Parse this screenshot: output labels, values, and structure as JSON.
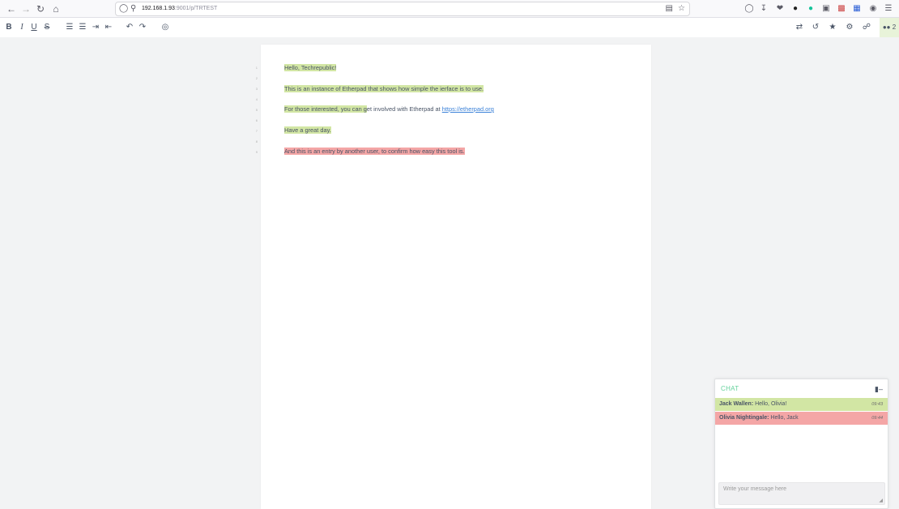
{
  "browser": {
    "url_host": "192.168.1.93",
    "url_rest": ":9001/p/TRTEST",
    "icons": [
      "back-icon",
      "forward-icon",
      "reload-icon",
      "home-icon"
    ],
    "extension_icons": [
      "pocket-icon",
      "download-icon",
      "extension-icon",
      "extension-icon-2",
      "grammarly-icon",
      "reader-icon",
      "extension-icon-3",
      "extension-icon-4",
      "extension-icon-5",
      "menu-icon"
    ]
  },
  "toolbar": {
    "left": [
      "bold-icon",
      "italic-icon",
      "underline-icon",
      "strikethrough-icon",
      "ordered-list-icon",
      "unordered-list-icon",
      "indent-icon",
      "outdent-icon",
      "undo-icon",
      "redo-icon",
      "clear-authorship-icon"
    ],
    "right": [
      "import-export-icon",
      "timeslider-icon",
      "star-icon",
      "settings-icon",
      "share-icon"
    ],
    "user_count": "2"
  },
  "pad": {
    "line_numbers": [
      "1",
      "2",
      "3",
      "4",
      "5",
      "6",
      "7",
      "8",
      "9"
    ],
    "lines": [
      {
        "text": "Hello, Techrepublic!"
      },
      {
        "text": ""
      },
      {
        "text": "This is an instance of Etherpad that shows how simple the ierface is to use."
      },
      {
        "text": ""
      },
      {
        "text_a": "For those interested, you can g",
        "text_b": "et involved with Etherpad at ",
        "link": "https://etherpad.org"
      },
      {
        "text": ""
      },
      {
        "text": "Have a great day."
      },
      {
        "text": ""
      },
      {
        "text": "And this is an entry by another user, to confirm how easy this tool is."
      }
    ]
  },
  "chat": {
    "title": "CHAT",
    "messages": [
      {
        "author": "Jack Wallen:",
        "text": " Hello, Olivia!",
        "time": "09:43"
      },
      {
        "author": "Olivia Nightingale:",
        "text": " Hello, Jack",
        "time": "09:44"
      }
    ],
    "input_placeholder": "Write your message here"
  },
  "colors": {
    "author_1": "#d2e6a4",
    "author_2": "#f4a6a6",
    "chat_title": "#64d29b",
    "link": "#3a81d8"
  }
}
